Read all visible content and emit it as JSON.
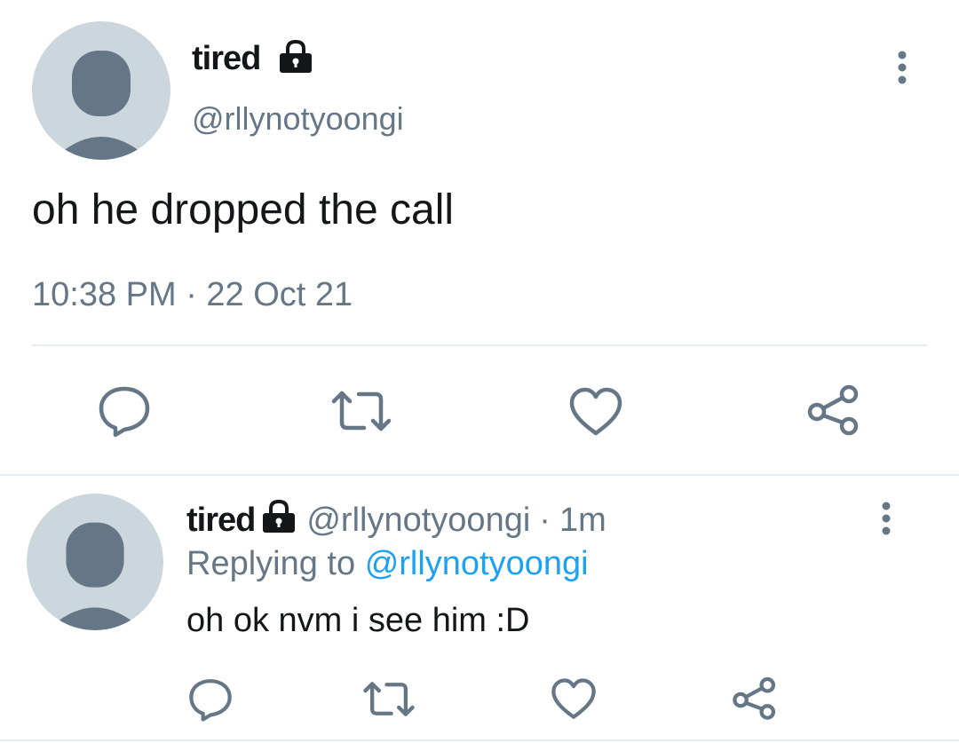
{
  "main_tweet": {
    "display_name": "tired",
    "handle": "@rllynotyoongi",
    "text": "oh he dropped the call",
    "timestamp": "10:38 PM · 22 Oct 21",
    "icons": {
      "avatar": "default-avatar-icon",
      "protected": "lock-icon",
      "more": "more-vertical-icon",
      "reply": "reply-icon",
      "retweet": "retweet-icon",
      "like": "heart-icon",
      "share": "share-icon"
    }
  },
  "reply_tweet": {
    "display_name": "tired",
    "handle": "@rllynotyoongi",
    "separator": "·",
    "time": "1m",
    "replying_prefix": "Replying to",
    "replying_handle": "@rllynotyoongi",
    "text": "oh ok nvm i see him :D"
  },
  "colors": {
    "text": "#14171a",
    "secondary": "#657786",
    "link": "#1da1f2",
    "avatar_bg": "#ccd6dd",
    "avatar_fg": "#657786",
    "divider": "#e6ecf0"
  }
}
